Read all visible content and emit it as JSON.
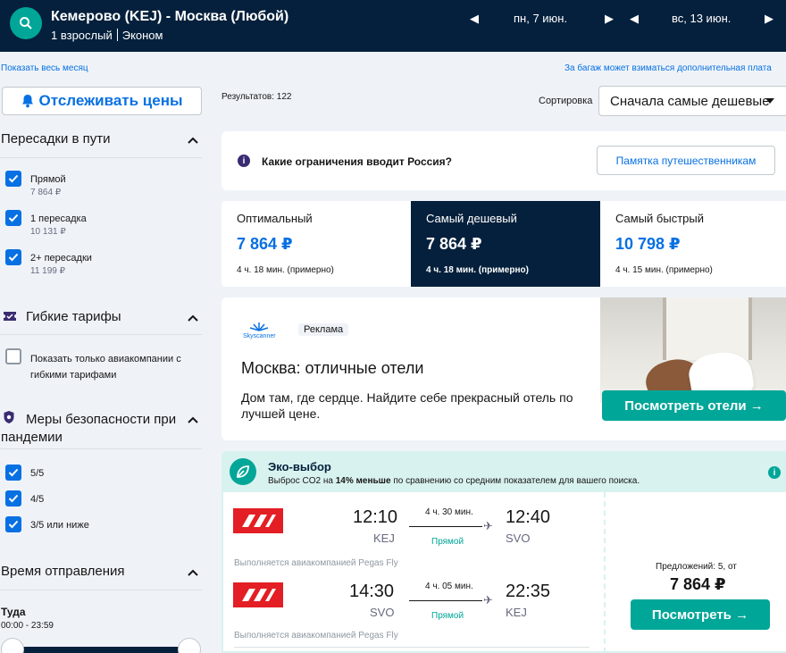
{
  "header": {
    "route": "Кемерово (KEJ) - Москва (Любой)",
    "passengers": "1 взрослый",
    "cabin": "Эконом",
    "depart_date": "пн, 7 июн.",
    "return_date": "вс, 13 июн."
  },
  "links": {
    "show_month": "Показать весь месяц",
    "baggage_note": "За багаж может взиматься дополнительная плата"
  },
  "sidebar": {
    "track_label": "Отслеживать цены",
    "stops": {
      "title": "Пересадки в пути",
      "items": [
        {
          "label": "Прямой",
          "price": "7 864 ₽",
          "checked": true
        },
        {
          "label": "1 пересадка",
          "price": "10 131 ₽",
          "checked": true
        },
        {
          "label": "2+ пересадки",
          "price": "11 199 ₽",
          "checked": true
        }
      ]
    },
    "flexible": {
      "title": "Гибкие тарифы",
      "item": "Показать только авиакомпании с гибкими тарифами"
    },
    "safety": {
      "title": "Меры безопасности при пандемии",
      "items": [
        {
          "label": "5/5",
          "checked": true
        },
        {
          "label": "4/5",
          "checked": true
        },
        {
          "label": "3/5 или ниже",
          "checked": true
        }
      ]
    },
    "departure": {
      "title": "Время отправления",
      "direction": "Туда",
      "range": "00:00 - 23:59"
    }
  },
  "main": {
    "results": "Результатов: 122",
    "sort_label": "Сортировка",
    "sort_value": "Сначала самые дешевые",
    "restrictions": {
      "question": "Какие ограничения вводит Россия?",
      "button": "Памятка путешественникам"
    },
    "tabs": [
      {
        "label": "Оптимальный",
        "price": "7 864 ₽",
        "duration": "4 ч. 18 мин. (примерно)",
        "active": false
      },
      {
        "label": "Самый дешевый",
        "price": "7 864 ₽",
        "duration": "4 ч. 18 мин. (примерно)",
        "active": true
      },
      {
        "label": "Самый быстрый",
        "price": "10 798 ₽",
        "duration": "4 ч. 15 мин. (примерно)",
        "active": false
      }
    ],
    "ad": {
      "brand": "Skyscanner",
      "badge": "Реклама",
      "headline": "Москва: отличные отели",
      "description": "Дом там, где сердце. Найдите себе прекрасный отель по лучшей цене.",
      "cta": "Посмотреть отели →"
    },
    "eco": {
      "title": "Эко-выбор",
      "text_pre": "Выброс CO2 на",
      "text_bold": "14% меньше",
      "text_post": "по сравнению со средним показателем для вашего поиска."
    },
    "flight": {
      "legs": [
        {
          "dep_time": "12:10",
          "dep_code": "KEJ",
          "duration": "4 ч. 30 мин.",
          "stops": "Прямой",
          "arr_time": "12:40",
          "arr_code": "SVO",
          "operator": "Выполняется авиакомпанией Pegas Fly"
        },
        {
          "dep_time": "14:30",
          "dep_code": "SVO",
          "duration": "4 ч. 05 мин.",
          "stops": "Прямой",
          "arr_time": "22:35",
          "arr_code": "KEJ",
          "operator": "Выполняется авиакомпанией Pegas Fly"
        }
      ],
      "offers": "Предложений: 5, от",
      "price": "7 864 ₽",
      "cta": "Посмотреть →"
    }
  },
  "colors": {
    "navy": "#05203c",
    "accent_blue": "#0770e3",
    "teal": "#00a698",
    "airline_red": "#e31e24"
  }
}
